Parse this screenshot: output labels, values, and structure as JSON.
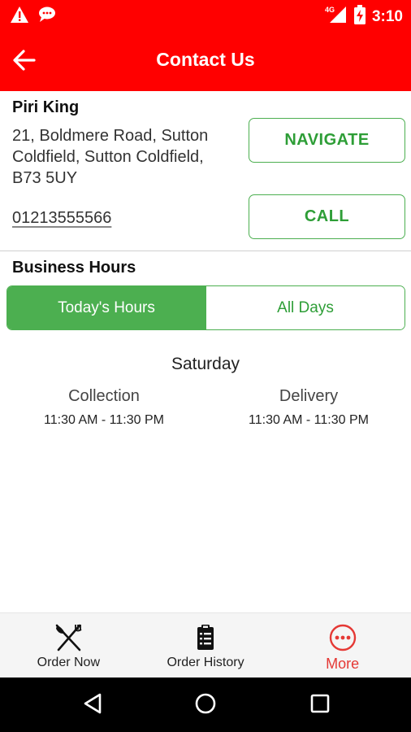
{
  "status_bar": {
    "time": "3:10",
    "network": "4G",
    "icons": [
      "warning-icon",
      "chat-bubble-icon",
      "signal-icon",
      "battery-charging-icon"
    ]
  },
  "appbar": {
    "title": "Contact Us",
    "back_icon": "arrow-left-icon"
  },
  "store": {
    "name": "Piri King",
    "address": "21, Boldmere Road, Sutton Coldfield, Sutton Coldfield, B73 5UY",
    "phone": "01213555566"
  },
  "actions": {
    "navigate_label": "NAVIGATE",
    "call_label": "CALL"
  },
  "hours": {
    "title": "Business Hours",
    "tabs": [
      {
        "label": "Today's Hours",
        "selected": true
      },
      {
        "label": "All Days",
        "selected": false
      }
    ],
    "day": "Saturday",
    "collection": {
      "label": "Collection",
      "time": "11:30 AM - 11:30 PM"
    },
    "delivery": {
      "label": "Delivery",
      "time": "11:30 AM - 11:30 PM"
    }
  },
  "bottom_nav": {
    "items": [
      {
        "label": "Order Now",
        "icon": "fork-knife-icon",
        "active": false
      },
      {
        "label": "Order History",
        "icon": "clipboard-icon",
        "active": false
      },
      {
        "label": "More",
        "icon": "more-dots-icon",
        "active": true
      }
    ]
  },
  "colors": {
    "brand_red": "#ff0000",
    "accent_green": "#4caf50",
    "active_nav_red": "#e53935"
  }
}
